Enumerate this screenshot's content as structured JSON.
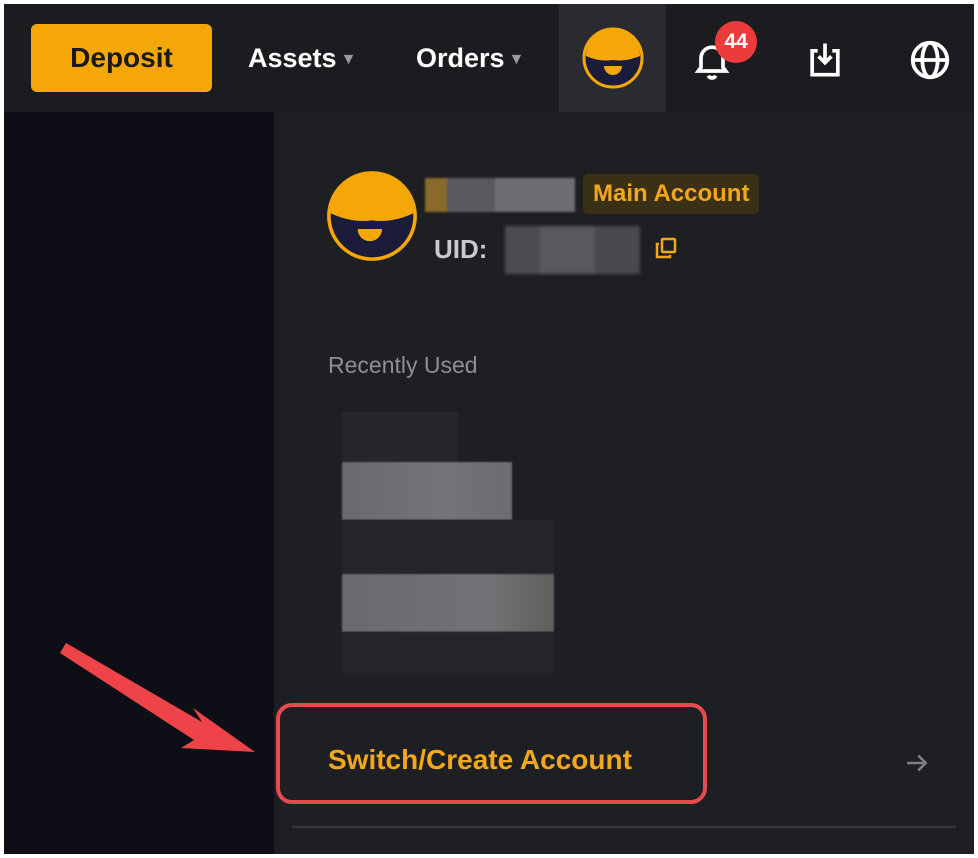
{
  "topbar": {
    "deposit_label": "Deposit",
    "assets_label": "Assets",
    "orders_label": "Orders",
    "notification_count": "44",
    "icons": [
      "avatar-icon",
      "bell-icon",
      "download-icon",
      "globe-icon"
    ]
  },
  "profile": {
    "badge": "Main Account",
    "uid_label": "UID:"
  },
  "recent": {
    "label": "Recently Used"
  },
  "switch": {
    "label": "Switch/Create Account",
    "arrow": "→"
  },
  "colors": {
    "accent": "#f6a708",
    "highlight": "#e84a4f",
    "panel": "#1e1f23",
    "topbar": "#1b1c20"
  }
}
